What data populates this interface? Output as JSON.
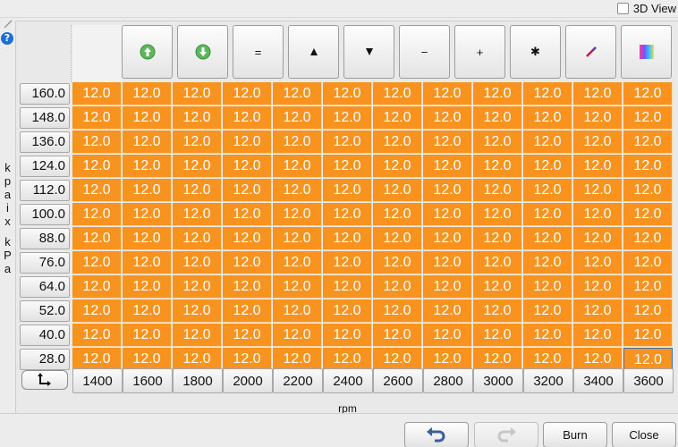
{
  "header": {
    "view3d_label": "3D View",
    "help_glyph": "?"
  },
  "y_axis": {
    "label_chars": [
      "k",
      "p",
      "a",
      "i",
      "x",
      "",
      "k",
      "P",
      "a"
    ],
    "values": [
      "160.0",
      "148.0",
      "136.0",
      "124.0",
      "112.0",
      "100.0",
      "88.0",
      "76.0",
      "64.0",
      "52.0",
      "40.0",
      "28.0"
    ]
  },
  "x_axis": {
    "label": "rpm",
    "values": [
      "1400",
      "1600",
      "1800",
      "2000",
      "2200",
      "2400",
      "2600",
      "2800",
      "3000",
      "3200",
      "3400",
      "3600"
    ]
  },
  "toolbar": [
    {
      "name": "increment-green-button",
      "icon": "green-up-arrow-icon",
      "label": ""
    },
    {
      "name": "decrement-green-button",
      "icon": "green-down-arrow-icon",
      "label": ""
    },
    {
      "name": "set-equal-button",
      "icon": "",
      "label": "="
    },
    {
      "name": "increase-button",
      "icon": "triangle-up-icon",
      "label": "▲"
    },
    {
      "name": "decrease-button",
      "icon": "triangle-down-icon",
      "label": "▼"
    },
    {
      "name": "subtract-button",
      "icon": "",
      "label": "−"
    },
    {
      "name": "add-button",
      "icon": "",
      "label": "+"
    },
    {
      "name": "multiply-button",
      "icon": "",
      "label": "✱"
    },
    {
      "name": "interpolate-button",
      "icon": "pencil-line-icon",
      "label": ""
    },
    {
      "name": "color-shade-button",
      "icon": "gradient-icon",
      "label": ""
    }
  ],
  "table": {
    "cell_value": "12.0",
    "cell_color": "#f7931e",
    "rows": [
      [
        "12.0",
        "12.0",
        "12.0",
        "12.0",
        "12.0",
        "12.0",
        "12.0",
        "12.0",
        "12.0",
        "12.0",
        "12.0",
        "12.0"
      ],
      [
        "12.0",
        "12.0",
        "12.0",
        "12.0",
        "12.0",
        "12.0",
        "12.0",
        "12.0",
        "12.0",
        "12.0",
        "12.0",
        "12.0"
      ],
      [
        "12.0",
        "12.0",
        "12.0",
        "12.0",
        "12.0",
        "12.0",
        "12.0",
        "12.0",
        "12.0",
        "12.0",
        "12.0",
        "12.0"
      ],
      [
        "12.0",
        "12.0",
        "12.0",
        "12.0",
        "12.0",
        "12.0",
        "12.0",
        "12.0",
        "12.0",
        "12.0",
        "12.0",
        "12.0"
      ],
      [
        "12.0",
        "12.0",
        "12.0",
        "12.0",
        "12.0",
        "12.0",
        "12.0",
        "12.0",
        "12.0",
        "12.0",
        "12.0",
        "12.0"
      ],
      [
        "12.0",
        "12.0",
        "12.0",
        "12.0",
        "12.0",
        "12.0",
        "12.0",
        "12.0",
        "12.0",
        "12.0",
        "12.0",
        "12.0"
      ],
      [
        "12.0",
        "12.0",
        "12.0",
        "12.0",
        "12.0",
        "12.0",
        "12.0",
        "12.0",
        "12.0",
        "12.0",
        "12.0",
        "12.0"
      ],
      [
        "12.0",
        "12.0",
        "12.0",
        "12.0",
        "12.0",
        "12.0",
        "12.0",
        "12.0",
        "12.0",
        "12.0",
        "12.0",
        "12.0"
      ],
      [
        "12.0",
        "12.0",
        "12.0",
        "12.0",
        "12.0",
        "12.0",
        "12.0",
        "12.0",
        "12.0",
        "12.0",
        "12.0",
        "12.0"
      ],
      [
        "12.0",
        "12.0",
        "12.0",
        "12.0",
        "12.0",
        "12.0",
        "12.0",
        "12.0",
        "12.0",
        "12.0",
        "12.0",
        "12.0"
      ],
      [
        "12.0",
        "12.0",
        "12.0",
        "12.0",
        "12.0",
        "12.0",
        "12.0",
        "12.0",
        "12.0",
        "12.0",
        "12.0",
        "12.0"
      ],
      [
        "12.0",
        "12.0",
        "12.0",
        "12.0",
        "12.0",
        "12.0",
        "12.0",
        "12.0",
        "12.0",
        "12.0",
        "12.0",
        "12.0"
      ]
    ]
  },
  "footer": {
    "undo_icon": "undo-arrow-icon",
    "redo_icon": "redo-arrow-icon",
    "burn_label": "Burn",
    "close_label": "Close"
  }
}
